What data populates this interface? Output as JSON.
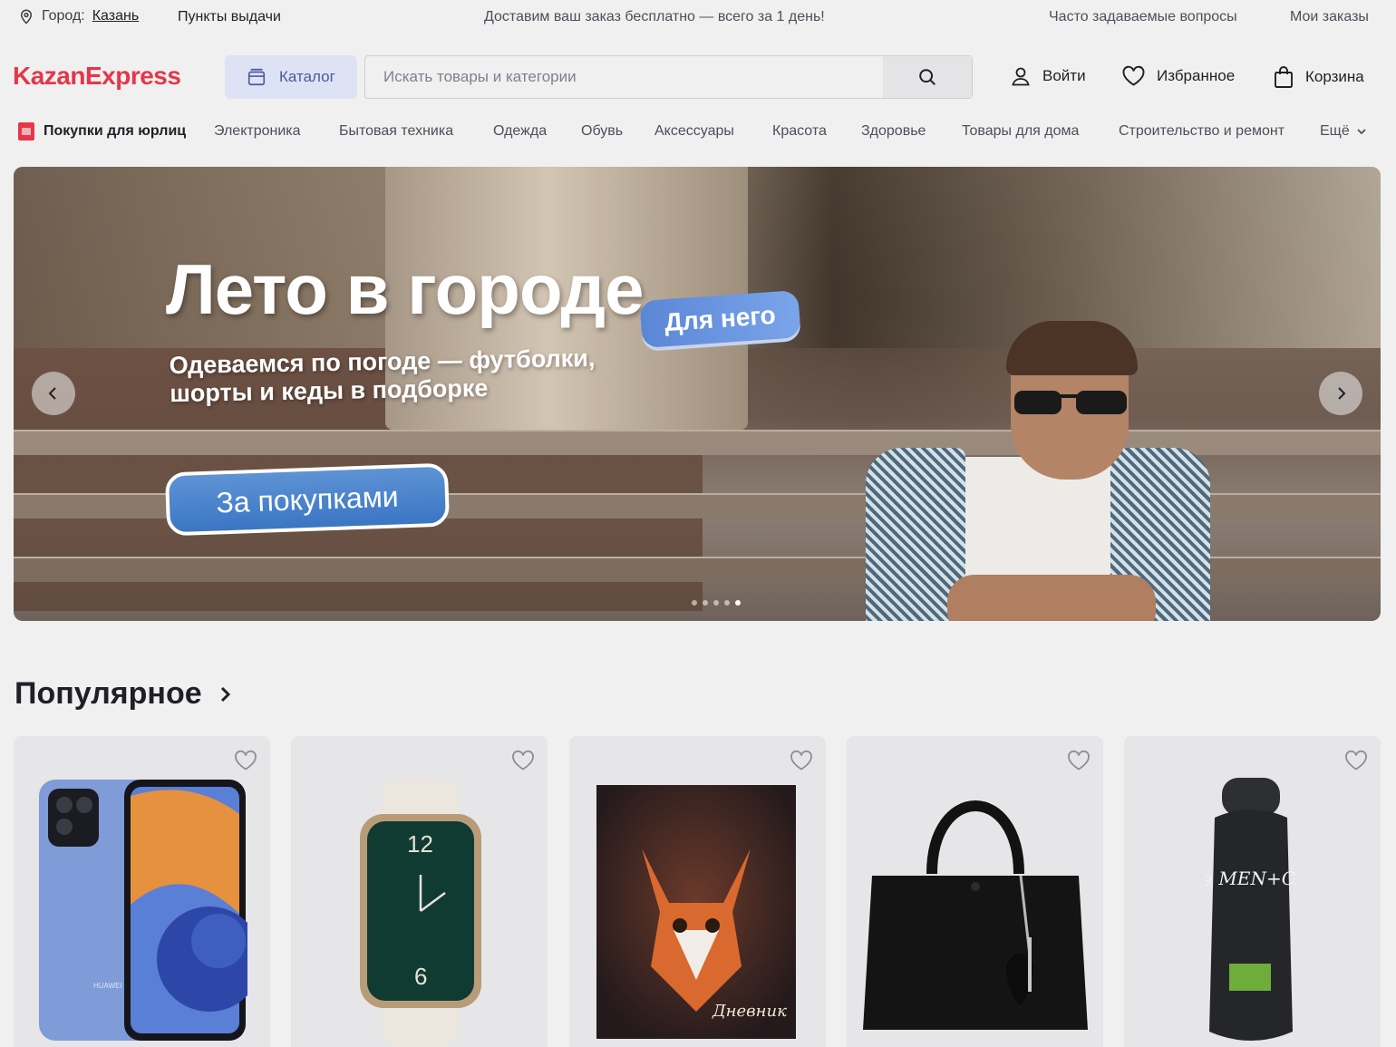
{
  "topbar": {
    "city_label": "Город:",
    "city_value": "Казань",
    "pickup_label": "Пункты выдачи",
    "promo_text": "Доставим ваш заказ бесплатно — всего за 1 день!",
    "faq_label": "Часто задаваемые вопросы",
    "orders_label": "Мои заказы"
  },
  "header": {
    "logo": "KazanExpress",
    "catalog_label": "Каталог",
    "search_placeholder": "Искать товары и категории",
    "login_label": "Войти",
    "favorites_label": "Избранное",
    "cart_label": "Корзина"
  },
  "catnav": {
    "business_label": "Покупки для юрлиц",
    "items": [
      "Электроника",
      "Бытовая техника",
      "Одежда",
      "Обувь",
      "Аксессуары",
      "Красота",
      "Здоровье",
      "Товары для дома",
      "Строительство и ремонт"
    ],
    "more_label": "Ещё"
  },
  "banner": {
    "title": "Лето в городе",
    "tag": "Для него",
    "subtitle_line1": "Одеваемся по погоде — футболки,",
    "subtitle_line2": "шорты и кеды в подборке",
    "cta_label": "За покупками",
    "slide_count": 5,
    "active_slide": 5
  },
  "popular": {
    "title": "Популярное",
    "products": [
      {
        "name": "smartphone-huawei",
        "brand_print": "HUAWEI"
      },
      {
        "name": "smart-watch"
      },
      {
        "name": "notebook-fox",
        "print": "Дневник"
      },
      {
        "name": "black-handbag"
      },
      {
        "name": "dove-men-shampoo",
        "brand_print": "Dove MEN+CARE"
      }
    ]
  },
  "colors": {
    "brand_red": "#e5374a",
    "catalog_bg": "#dde2f4",
    "cta_blue": "#3b76c4"
  }
}
